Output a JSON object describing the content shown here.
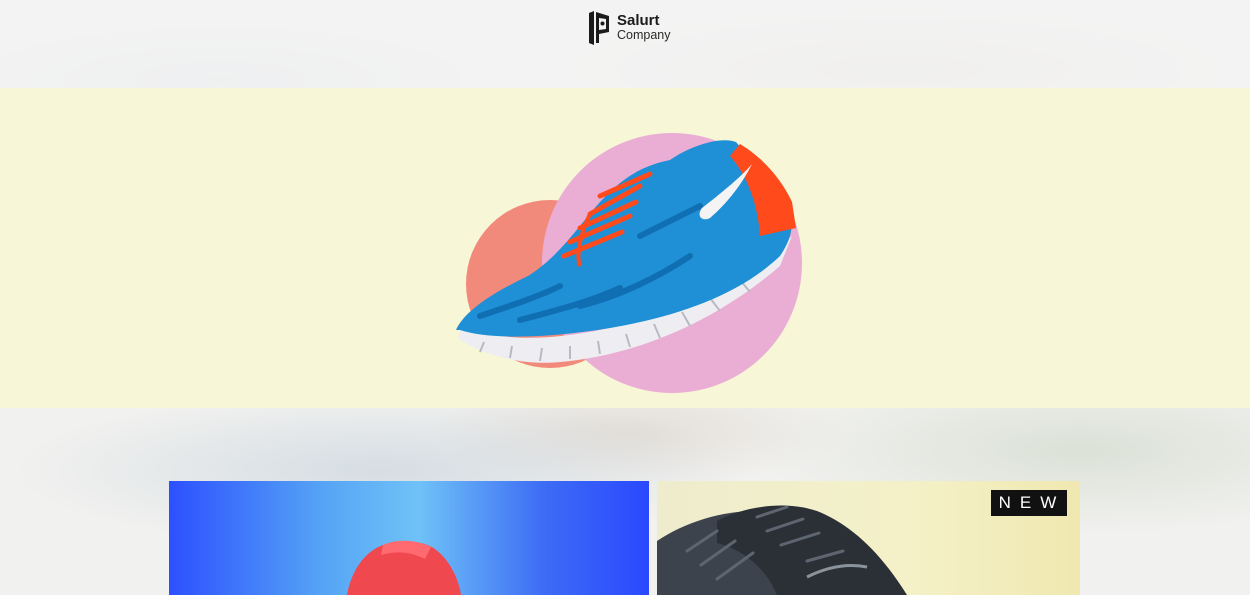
{
  "brand": {
    "name": "Salurt",
    "tagline": "Company",
    "logo_icon": "salurt-logo-icon"
  },
  "hero": {
    "image": "blue-running-shoe",
    "accent_colors": [
      "#f7f6d6",
      "#f28a7b",
      "#e9acd4",
      "#1f8fd6",
      "#ff4a1c"
    ]
  },
  "products": [
    {
      "image": "red-shoe-on-blue-gradient",
      "badge": ""
    },
    {
      "image": "dark-grey-running-shoes",
      "badge": "NEW"
    }
  ]
}
